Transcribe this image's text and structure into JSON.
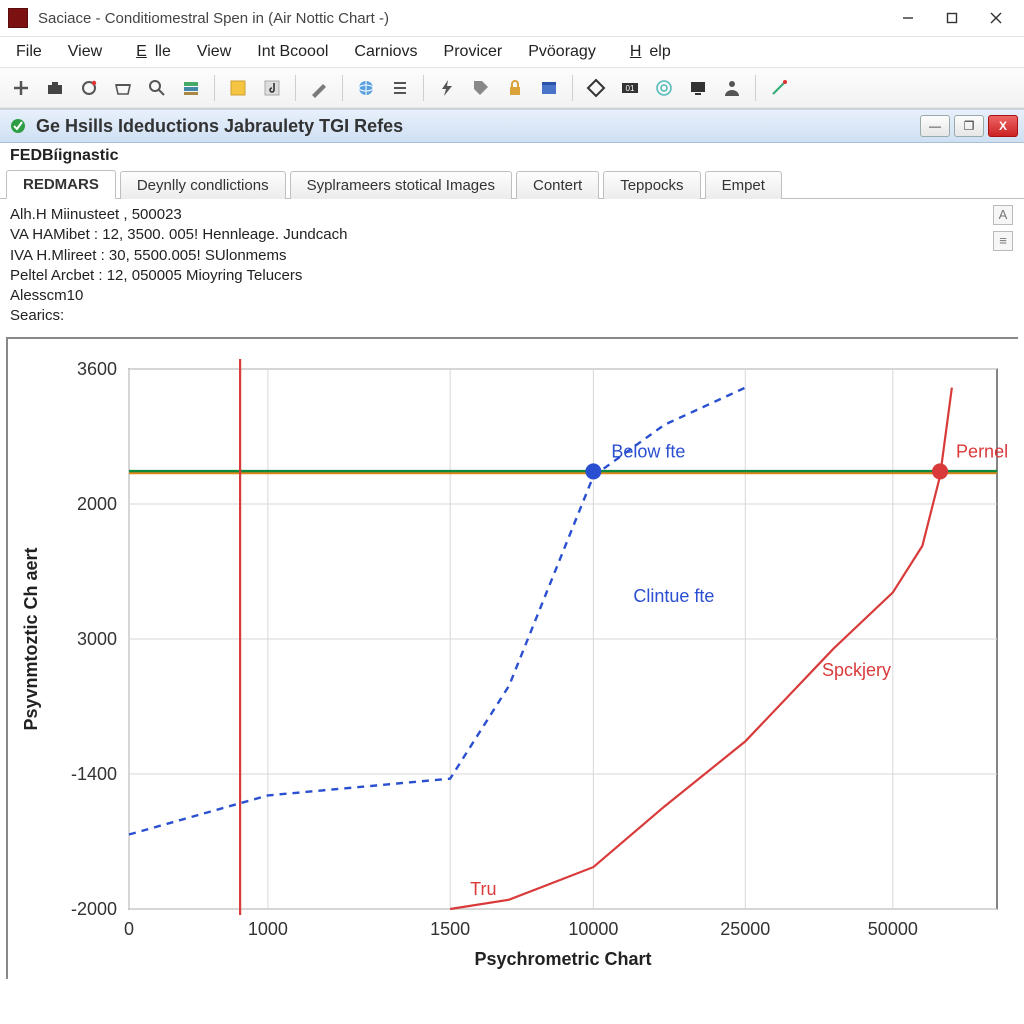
{
  "window": {
    "title": "Saciace - Conditiomestral Spen in (Air Nottic Chart -)"
  },
  "menus": [
    "File",
    "View",
    "Elle",
    "View",
    "Int Bcoool",
    "Carniovs",
    "Provicer",
    "Pvöoragy",
    "Help"
  ],
  "menu_underline_idx": [
    -1,
    -1,
    0,
    -1,
    -1,
    -1,
    -1,
    -1,
    0
  ],
  "toolbar_icons": [
    "plus-icon",
    "briefcase-icon",
    "refresh-icon",
    "basket-icon",
    "search-icon",
    "stack-icon",
    "|",
    "note-yellow-icon",
    "music-icon",
    "|",
    "pen-icon",
    "|",
    "globe-icon",
    "list-icon",
    "|",
    "bolt-icon",
    "tag-icon",
    "lock-icon",
    "window-icon",
    "|",
    "diamond-icon",
    "counter-icon",
    "target-icon",
    "monitor-icon",
    "person-icon",
    "|",
    "wand-icon"
  ],
  "subwindow": {
    "title": "Ge Hsills Ideductions Jabraulety TGI Refes",
    "header": "FEDBíignastic"
  },
  "tabs": [
    {
      "label": "REDMARS",
      "active": true
    },
    {
      "label": "Deynlly condlictions",
      "active": false
    },
    {
      "label": "Syplrameers stotical Images",
      "active": false
    },
    {
      "label": "Contert",
      "active": false
    },
    {
      "label": "Teppocks",
      "active": false
    },
    {
      "label": "Empet",
      "active": false
    }
  ],
  "info_lines": [
    "Alh.H Miinusteet , 500023",
    "VA HAMibet : 12, 3500. 005! Hennleage. Jundcach",
    "IVA H.Mlireet : 30, 5500.005! SUlonmems",
    "Peltel Arcbet : 12, 050005 Mioyring Telucers",
    "Alesscm10",
    "Searics:"
  ],
  "side_labels": [
    "A",
    "≡"
  ],
  "chart_data": {
    "type": "line",
    "title": "",
    "xlabel": "Psychrometric Chart",
    "ylabel": "Psyvnmtoztic Ch aert",
    "x_ticks": [
      0,
      1000,
      1500,
      10000,
      25000,
      50000
    ],
    "y_ticks": [
      -2000,
      -1400,
      3000,
      2000,
      3600
    ],
    "xlim": [
      0,
      60000
    ],
    "ylim": [
      -2000,
      3800
    ],
    "series": [
      {
        "name": "Clintue fte",
        "style": "blue-dashed",
        "label_series": "Clintue fte",
        "label_point": "Below fte",
        "x": [
          0,
          1000,
          1500,
          5000,
          10000,
          17000,
          25000
        ],
        "values": [
          -1200,
          -780,
          -600,
          400,
          2650,
          3200,
          3600
        ],
        "marker": {
          "x": 10000,
          "y": 2700
        }
      },
      {
        "name": "Spckjery",
        "style": "red-solid",
        "label_series": "Spckjery",
        "label_point": "Pernel",
        "label_tail": "Tru",
        "x": [
          1500,
          5000,
          10000,
          17000,
          25000,
          40000,
          50000,
          55000,
          58000,
          60000
        ],
        "values": [
          -2000,
          -1900,
          -1550,
          -900,
          -200,
          800,
          1400,
          1900,
          2650,
          3600
        ],
        "marker": {
          "x": 58000,
          "y": 2700
        }
      }
    ],
    "reference_lines": {
      "horizontal": [
        {
          "name": "green",
          "y": 2700,
          "color": "#0a8a3a"
        },
        {
          "name": "orange",
          "y": 2680,
          "color": "#d9861a"
        }
      ],
      "vertical": [
        {
          "name": "red",
          "x": 800,
          "color": "#d93a3a"
        }
      ]
    }
  }
}
